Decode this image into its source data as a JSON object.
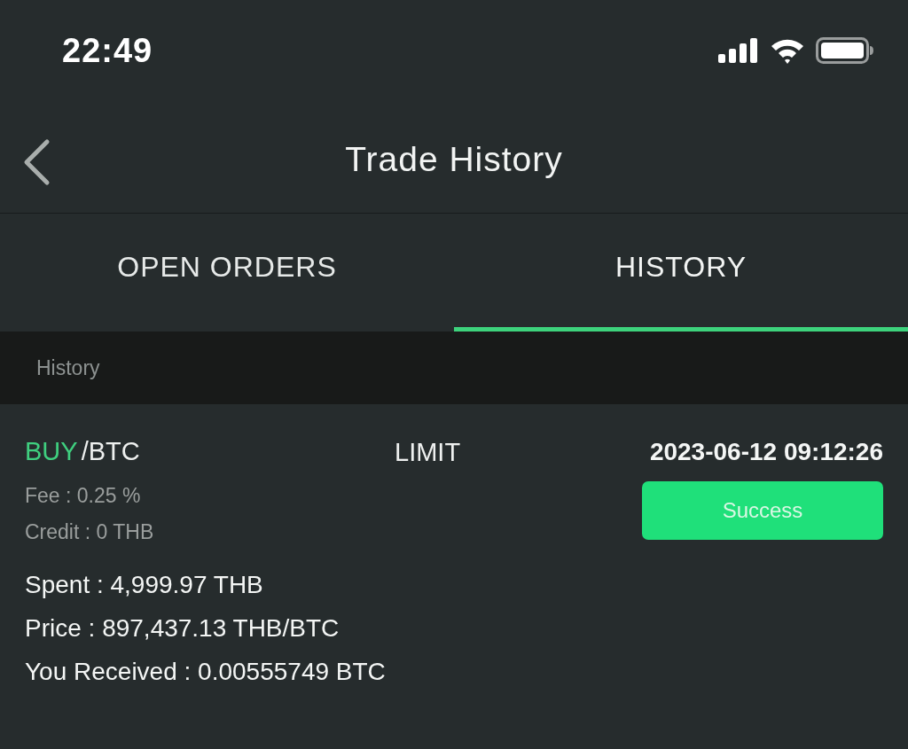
{
  "status_bar": {
    "time": "22:49"
  },
  "header": {
    "title": "Trade History"
  },
  "tabs": [
    {
      "label": "OPEN ORDERS",
      "selected": false
    },
    {
      "label": "HISTORY",
      "selected": true
    }
  ],
  "section": {
    "title": "History"
  },
  "orders": [
    {
      "side": "BUY",
      "pair": "/BTC",
      "type": "LIMIT",
      "datetime": "2023-06-12 09:12:26",
      "fee": "Fee : 0.25 %",
      "credit": "Credit : 0 THB",
      "status": "Success",
      "details": [
        "Spent : 4,999.97 THB",
        "Price : 897,437.13 THB/BTC",
        "You Received : 0.00555749 BTC"
      ]
    }
  ]
}
